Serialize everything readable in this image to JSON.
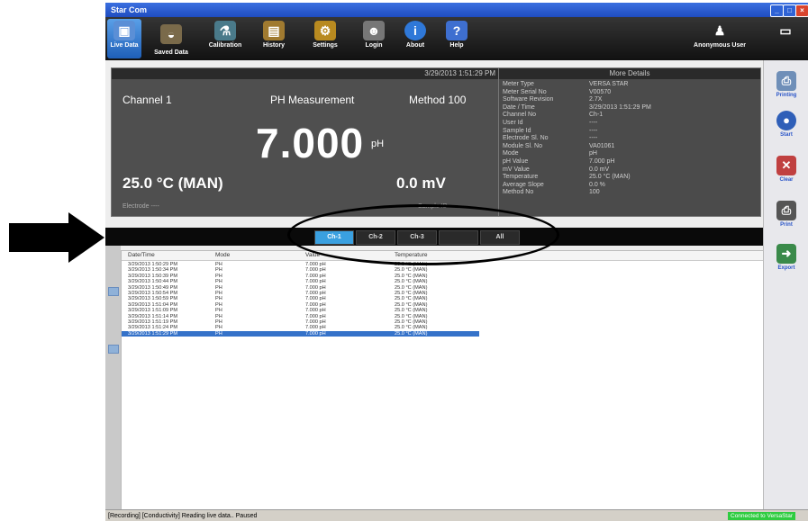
{
  "window": {
    "title": "Star Com"
  },
  "toolbar": {
    "items": [
      {
        "label": "Live Data",
        "icon": "live-data-icon"
      },
      {
        "label": "Saved Data",
        "icon": "saved-data-icon"
      },
      {
        "label": "Calibration",
        "icon": "calibration-icon"
      },
      {
        "label": "History",
        "icon": "history-icon"
      },
      {
        "label": "Settings",
        "icon": "settings-icon"
      },
      {
        "label": "Login",
        "icon": "login-icon"
      },
      {
        "label": "About",
        "icon": "about-icon"
      },
      {
        "label": "Help",
        "icon": "help-icon"
      }
    ],
    "user": "Anonymous User"
  },
  "live": {
    "timestamp": "3/29/2013 1:51:29 PM",
    "channel": "Channel 1",
    "measurement": "PH Measurement",
    "method": "Method 100",
    "value": "7.000",
    "unit": "pH",
    "temperature": "25.0 °C (MAN)",
    "mv": "0.0 mV",
    "electrode": "Electrode ----",
    "sample_id": "Sample ID ----"
  },
  "details": {
    "title": "More Details",
    "rows": [
      {
        "label": "Meter Type",
        "value": "VERSA STAR"
      },
      {
        "label": "Meter Serial No",
        "value": "V00570"
      },
      {
        "label": "Software Revision",
        "value": "2.7X"
      },
      {
        "label": "Date / Time",
        "value": "3/29/2013 1:51:29 PM"
      },
      {
        "label": "Channel No",
        "value": "Ch-1"
      },
      {
        "label": "User Id",
        "value": "----"
      },
      {
        "label": "Sample Id",
        "value": "----"
      },
      {
        "label": "Electrode Sl. No",
        "value": "----"
      },
      {
        "label": "Module Sl. No",
        "value": "VA01061"
      },
      {
        "label": "Mode",
        "value": "pH"
      },
      {
        "label": "pH Value",
        "value": "7.000 pH"
      },
      {
        "label": "mV Value",
        "value": "0.0 mV"
      },
      {
        "label": "Temperature",
        "value": "25.0 °C (MAN)"
      },
      {
        "label": "Average Slope",
        "value": "0.0 %"
      },
      {
        "label": "Method No",
        "value": "100"
      }
    ]
  },
  "channels": [
    "Ch-1",
    "Ch-2",
    "Ch-3",
    "",
    "All"
  ],
  "grid": {
    "columns": [
      "Date/Time",
      "Mode",
      "Value",
      "Temperature"
    ],
    "rows": [
      [
        "3/29/2013 1:50:29 PM",
        "PH",
        "7.000 pH",
        "25.0 °C (MAN)"
      ],
      [
        "3/29/2013 1:50:34 PM",
        "PH",
        "7.000 pH",
        "25.0 °C (MAN)"
      ],
      [
        "3/29/2013 1:50:39 PM",
        "PH",
        "7.000 pH",
        "25.0 °C (MAN)"
      ],
      [
        "3/29/2013 1:50:44 PM",
        "PH",
        "7.000 pH",
        "25.0 °C (MAN)"
      ],
      [
        "3/29/2013 1:50:49 PM",
        "PH",
        "7.000 pH",
        "25.0 °C (MAN)"
      ],
      [
        "3/29/2013 1:50:54 PM",
        "PH",
        "7.000 pH",
        "25.0 °C (MAN)"
      ],
      [
        "3/29/2013 1:50:59 PM",
        "PH",
        "7.000 pH",
        "25.0 °C (MAN)"
      ],
      [
        "3/29/2013 1:51:04 PM",
        "PH",
        "7.000 pH",
        "25.0 °C (MAN)"
      ],
      [
        "3/29/2013 1:51:09 PM",
        "PH",
        "7.000 pH",
        "25.0 °C (MAN)"
      ],
      [
        "3/29/2013 1:51:14 PM",
        "PH",
        "7.000 pH",
        "25.0 °C (MAN)"
      ],
      [
        "3/29/2013 1:51:19 PM",
        "PH",
        "7.000 pH",
        "25.0 °C (MAN)"
      ],
      [
        "3/29/2013 1:51:24 PM",
        "PH",
        "7.000 pH",
        "25.0 °C (MAN)"
      ],
      [
        "3/29/2013 1:51:29 PM",
        "PH",
        "7.000 pH",
        "25.0 °C (MAN)"
      ]
    ]
  },
  "sidebar": {
    "items": [
      {
        "label": "Printing",
        "icon": "printer-icon"
      },
      {
        "label": "Start",
        "icon": "start-icon"
      },
      {
        "label": "Clear",
        "icon": "clear-icon"
      },
      {
        "label": "Print",
        "icon": "print-icon"
      },
      {
        "label": "Export",
        "icon": "export-icon"
      }
    ]
  },
  "status": {
    "text": "[Recording] [Conductivity] Reading live data.. Paused",
    "connected": "Connected to VersaStar"
  },
  "colors": {
    "accent": "#3aa0e0",
    "selected_row": "#3572c9",
    "connected": "#2ecc40"
  }
}
